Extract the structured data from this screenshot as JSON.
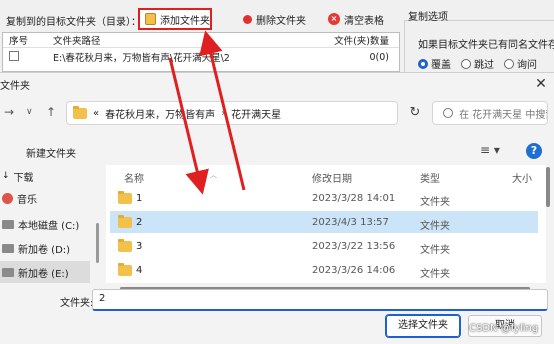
{
  "app": {
    "title": "复制到的目标文件夹（目录）：",
    "add_btn": "添加文件夹",
    "delete_btn": "删除文件夹",
    "clear_btn": "清空表格",
    "table": {
      "headers": [
        "序号",
        "文件夹路径",
        "文件(夹)数量"
      ],
      "rows": [
        {
          "path": "E:\\春花秋月来，万物皆有声\\花开满天星\\2",
          "count": "0(0)"
        }
      ]
    },
    "options": {
      "title": "复制选项",
      "desc": "如果目标文件夹已有同名文件存在",
      "radios": [
        "覆盖",
        "跳过",
        "询问"
      ]
    }
  },
  "dialog": {
    "title": "文件夹",
    "address": {
      "prefix": "«",
      "crumbs": [
        "春花秋月来，万物皆有声",
        "花开满天星"
      ]
    },
    "search_placeholder": "在 花开满天星 中搜索",
    "new_folder": "新建文件夹",
    "nav": [
      {
        "label": "下载"
      },
      {
        "label": "音乐"
      },
      {
        "label": "本地磁盘 (C:)"
      },
      {
        "label": "新加卷 (D:)"
      },
      {
        "label": "新加卷 (E:)"
      }
    ],
    "columns": [
      "名称",
      "修改日期",
      "类型",
      "大小"
    ],
    "files": [
      {
        "name": "1",
        "date": "2023/3/28 14:01",
        "type": "文件夹"
      },
      {
        "name": "2",
        "date": "2023/4/3 13:57",
        "type": "文件夹"
      },
      {
        "name": "3",
        "date": "2023/3/22 13:56",
        "type": "文件夹"
      },
      {
        "name": "4",
        "date": "2023/3/26 14:06",
        "type": "文件夹"
      }
    ],
    "filename_label": "文件夹:",
    "filename_value": "2",
    "ok_btn": "选择文件夹",
    "cancel_btn": "取消"
  },
  "watermark": "CSDN @fyling",
  "colors": {
    "highlight_red": "#e02020",
    "accent_blue": "#1e5fd1",
    "selection": "#cce4f7"
  }
}
